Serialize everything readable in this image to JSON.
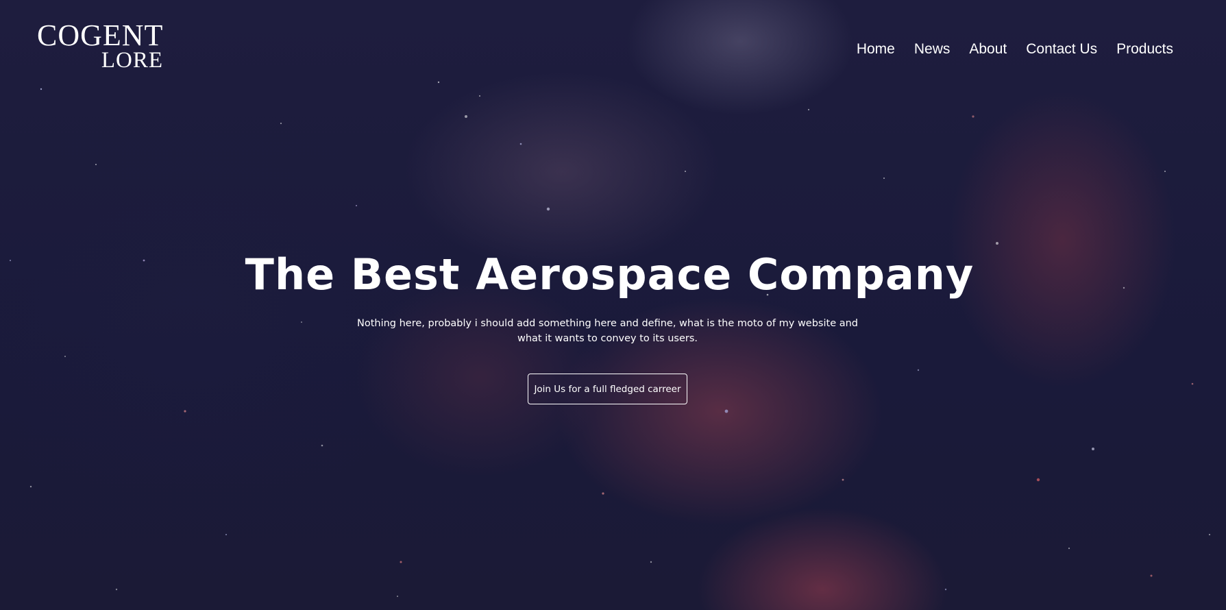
{
  "brand": {
    "line1": "COGENT",
    "line2": "LORE"
  },
  "nav": {
    "items": [
      "Home",
      "News",
      "About",
      "Contact Us",
      "Products"
    ]
  },
  "hero": {
    "headline": "The Best Aerospace Company",
    "subtitle": "Nothing here, probably i should add something here and define, what is the moto of my website and what it wants to convey to its users.",
    "cta_label": "Join Us for a full fledged carreer"
  },
  "colors": {
    "text": "#ffffff",
    "background": "#1a1a38",
    "nebula_red": "#9e3e50"
  }
}
